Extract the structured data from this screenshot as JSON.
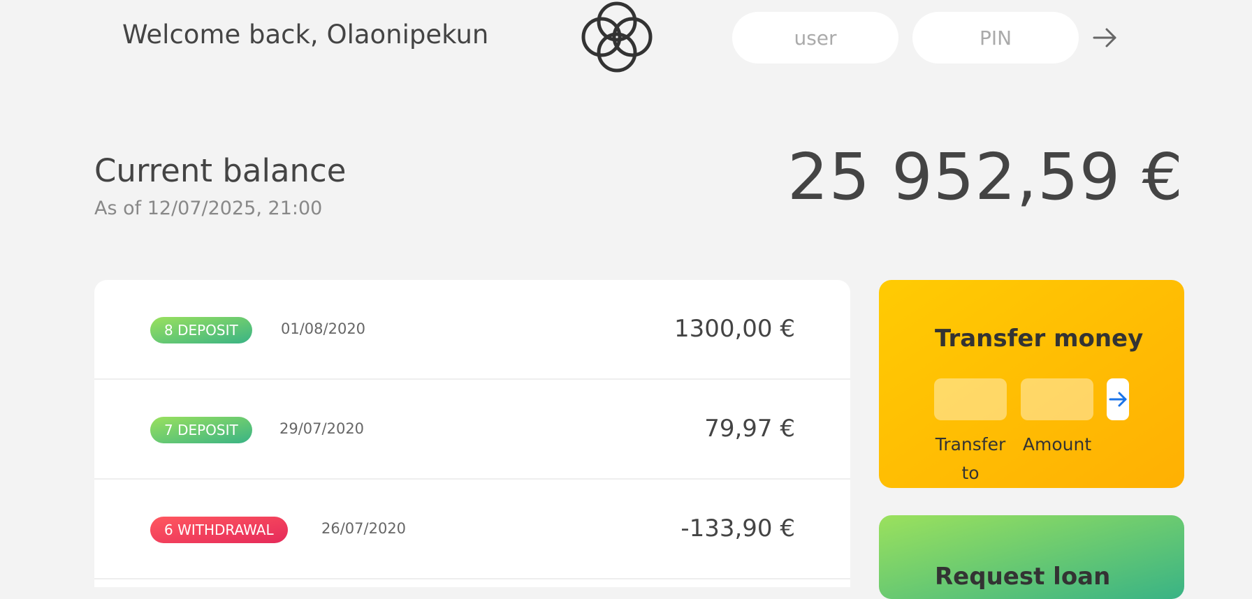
{
  "nav": {
    "welcome": "Welcome back, Olaonipekun",
    "logo_icon": "four-rings-logo-icon",
    "user_placeholder": "user",
    "pin_placeholder": "PIN",
    "login_icon": "arrow-right-icon"
  },
  "balance": {
    "label": "Current balance",
    "date": "As of 12/07/2025, 21:00",
    "value": "25 952,59 €"
  },
  "movements": [
    {
      "type_label": "8 DEPOSIT",
      "kind": "deposit",
      "date": "01/08/2020",
      "value": "1300,00 €"
    },
    {
      "type_label": "7 DEPOSIT",
      "kind": "deposit",
      "date": "29/07/2020",
      "value": "79,97 €"
    },
    {
      "type_label": "6 WITHDRAWAL",
      "kind": "withdrawal",
      "date": "26/07/2020",
      "value": "-133,90 €"
    }
  ],
  "transfer": {
    "title": "Transfer money",
    "to_label": "Transfer to",
    "amount_label": "Amount",
    "submit_icon": "arrow-right-icon"
  },
  "loan": {
    "title": "Request loan"
  },
  "colors": {
    "background": "#f3f3f3",
    "deposit": "#39b385",
    "withdrawal": "#e52a5a",
    "transfer_bg": "#ffbb03",
    "accent_arrow": "#1a73e8"
  }
}
